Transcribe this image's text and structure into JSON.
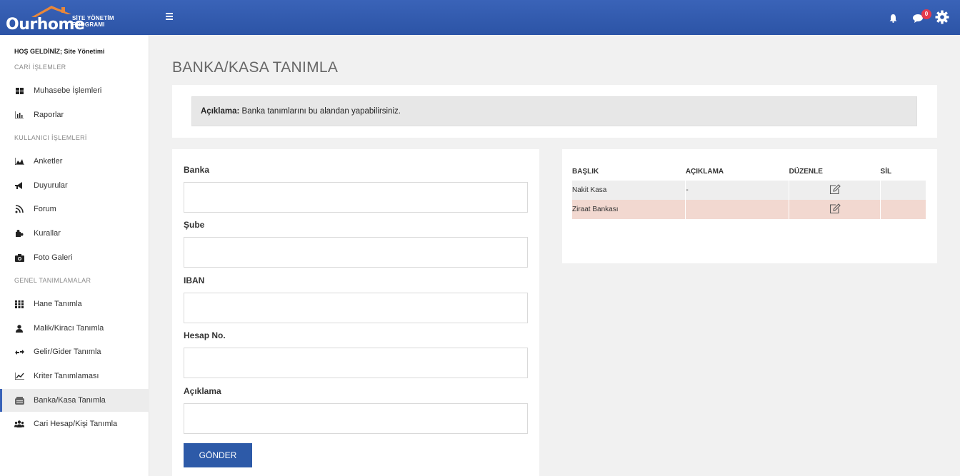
{
  "header": {
    "logo_text": "Ourhome",
    "logo_subtitle": "SİTE YÖNETİM PROGRAMI",
    "notification_count": "0"
  },
  "sidebar": {
    "welcome": "HOŞ GELDİNİZ; Site Yönetimi",
    "sections": [
      {
        "title": "CARİ İŞLEMLER"
      },
      {
        "title": "KULLANICI İŞLEMLERİ"
      },
      {
        "title": "GENEL TANIMLAMALAR"
      }
    ],
    "items": [
      {
        "label": "Muhasebe İşlemleri",
        "icon": "dashboard-icon"
      },
      {
        "label": "Raporlar",
        "icon": "bar-chart-icon"
      },
      {
        "label": "Anketler",
        "icon": "area-chart-icon"
      },
      {
        "label": "Duyurular",
        "icon": "bullhorn-icon"
      },
      {
        "label": "Forum",
        "icon": "feed-icon"
      },
      {
        "label": "Kurallar",
        "icon": "puzzle-icon"
      },
      {
        "label": "Foto Galeri",
        "icon": "camera-icon"
      },
      {
        "label": "Hane Tanımla",
        "icon": "grid-icon"
      },
      {
        "label": "Malik/Kiracı Tanımla",
        "icon": "user-icon"
      },
      {
        "label": "Gelir/Gider Tanımla",
        "icon": "exchange-icon"
      },
      {
        "label": "Kriter Tanımlaması",
        "icon": "line-chart-icon"
      },
      {
        "label": "Banka/Kasa Tanımla",
        "icon": "bank-icon"
      },
      {
        "label": "Cari Hesap/Kişi Tanımla",
        "icon": "users-icon"
      }
    ]
  },
  "page": {
    "title": "BANKA/KASA TANIMLA",
    "info_label": "Açıklama:",
    "info_text": " Banka tanımlarını bu alandan yapabilirsiniz."
  },
  "form": {
    "fields": [
      {
        "label": "Banka",
        "value": ""
      },
      {
        "label": "Şube",
        "value": ""
      },
      {
        "label": "IBAN",
        "value": ""
      },
      {
        "label": "Hesap No.",
        "value": ""
      },
      {
        "label": "Açıklama",
        "value": ""
      }
    ],
    "submit_label": "GÖNDER"
  },
  "table": {
    "columns": [
      "BAŞLIK",
      "AÇIKLAMA",
      "DÜZENLE",
      "SİL"
    ],
    "rows": [
      {
        "baslik": "Nakit Kasa",
        "aciklama": "-"
      },
      {
        "baslik": "Ziraat Bankası",
        "aciklama": ""
      }
    ]
  },
  "colors": {
    "topbar": "#3a63b8",
    "primary_button": "#2d5aa8",
    "row_highlight": "#f2d8d0",
    "badge": "#e53a4d"
  }
}
